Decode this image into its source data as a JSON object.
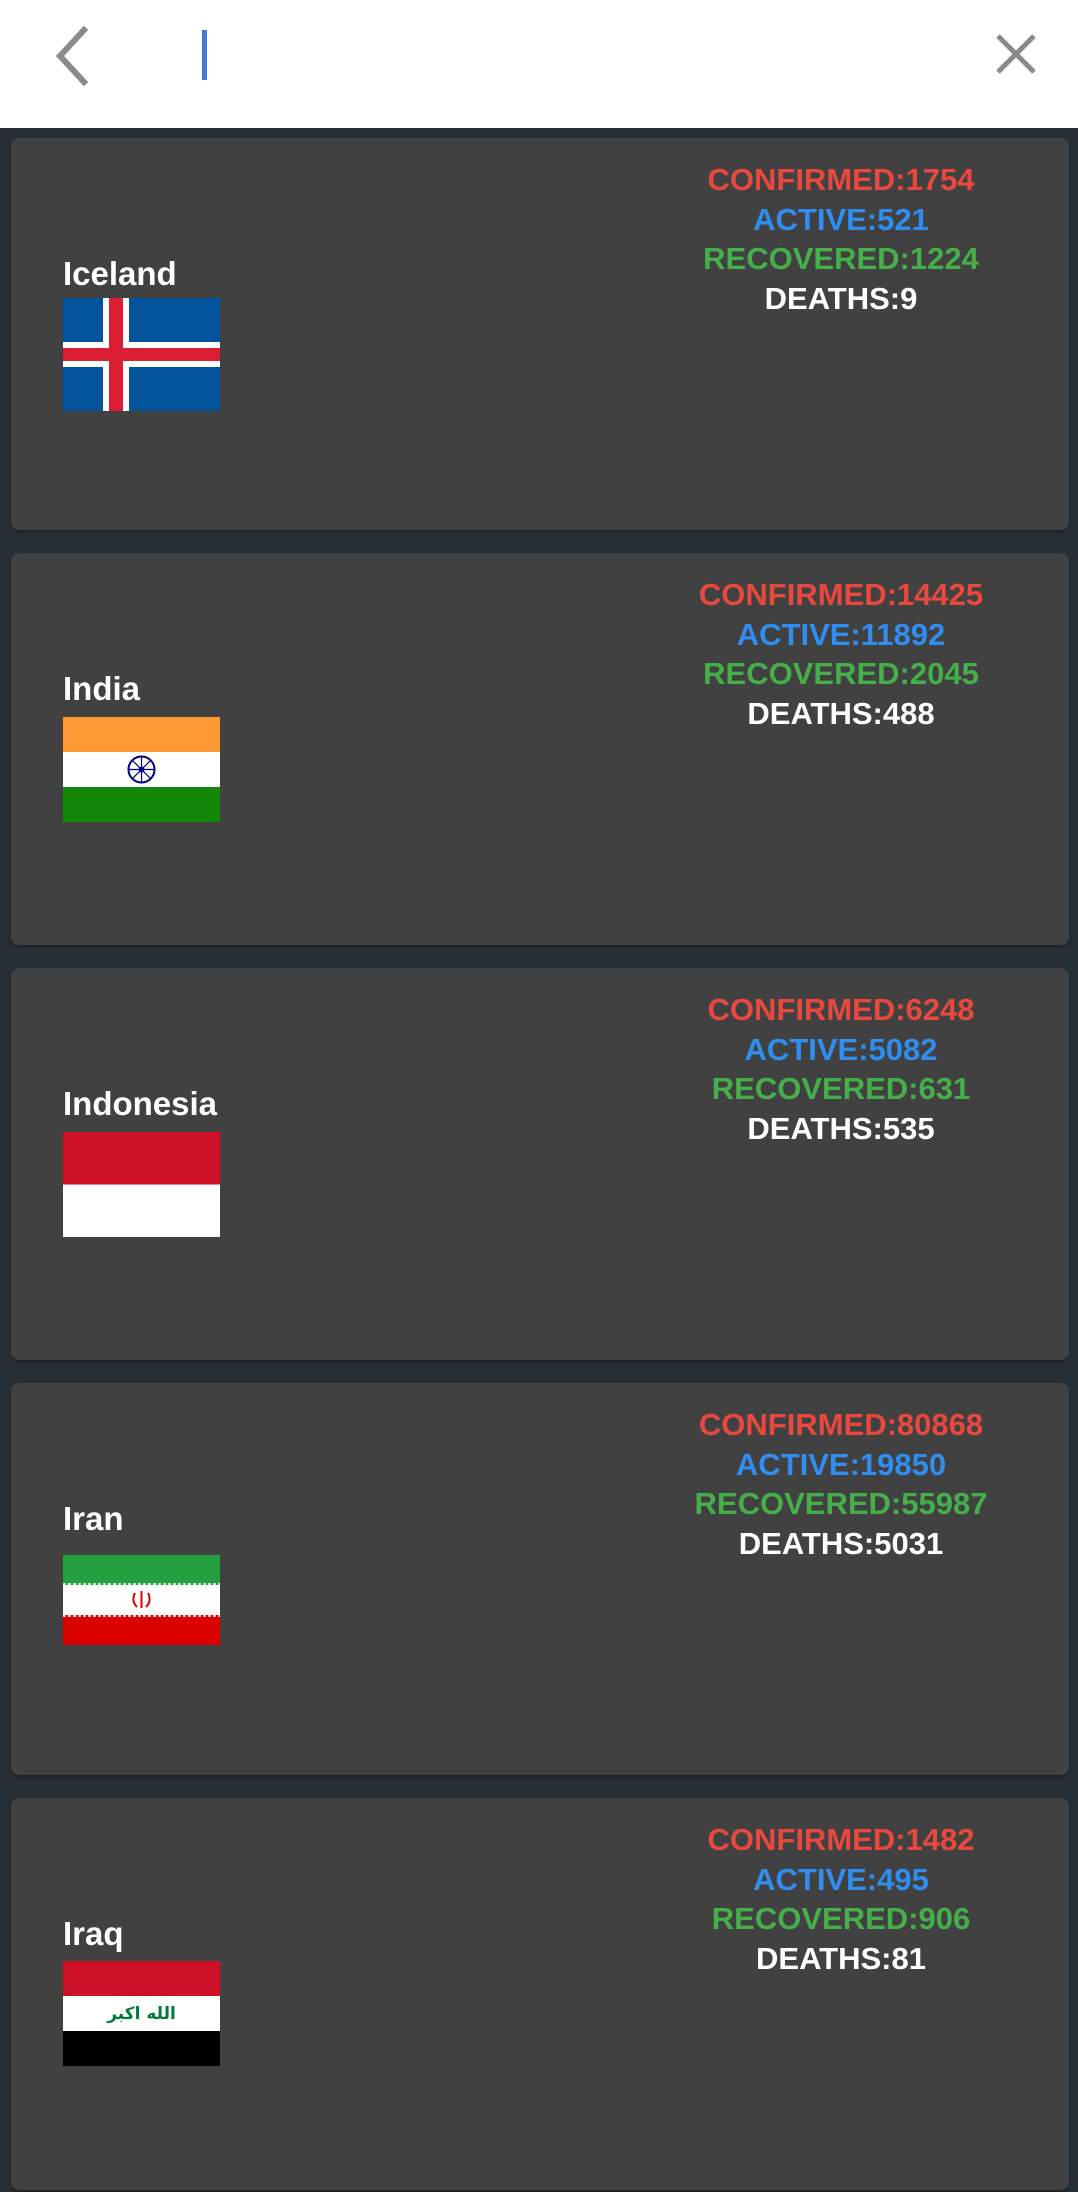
{
  "search": {
    "value": "",
    "placeholder": ""
  },
  "icons": {
    "back": "chevron-left-icon",
    "close": "close-icon"
  },
  "colors": {
    "confirmed": "#e8483e",
    "active": "#2f8ef0",
    "recovered": "#45b04a",
    "deaths": "#ffffff",
    "card": "#414141",
    "background": "#273036",
    "caret": "#3d7be0"
  },
  "countries": [
    {
      "name": "Iceland",
      "flag": "iceland-flag",
      "confirmed": "CONFIRMED:1754",
      "active": "ACTIVE:521",
      "recovered": "RECOVERED:1224",
      "deaths": "DEATHS:9"
    },
    {
      "name": "India",
      "flag": "india-flag",
      "confirmed": "CONFIRMED:14425",
      "active": "ACTIVE:11892",
      "recovered": "RECOVERED:2045",
      "deaths": "DEATHS:488"
    },
    {
      "name": "Indonesia",
      "flag": "indonesia-flag",
      "confirmed": "CONFIRMED:6248",
      "active": "ACTIVE:5082",
      "recovered": "RECOVERED:631",
      "deaths": "DEATHS:535"
    },
    {
      "name": "Iran",
      "flag": "iran-flag",
      "confirmed": "CONFIRMED:80868",
      "active": "ACTIVE:19850",
      "recovered": "RECOVERED:55987",
      "deaths": "DEATHS:5031"
    },
    {
      "name": "Iraq",
      "flag": "iraq-flag",
      "flag_text": "الله اكبر",
      "confirmed": "CONFIRMED:1482",
      "active": "ACTIVE:495",
      "recovered": "RECOVERED:906",
      "deaths": "DEATHS:81"
    }
  ]
}
